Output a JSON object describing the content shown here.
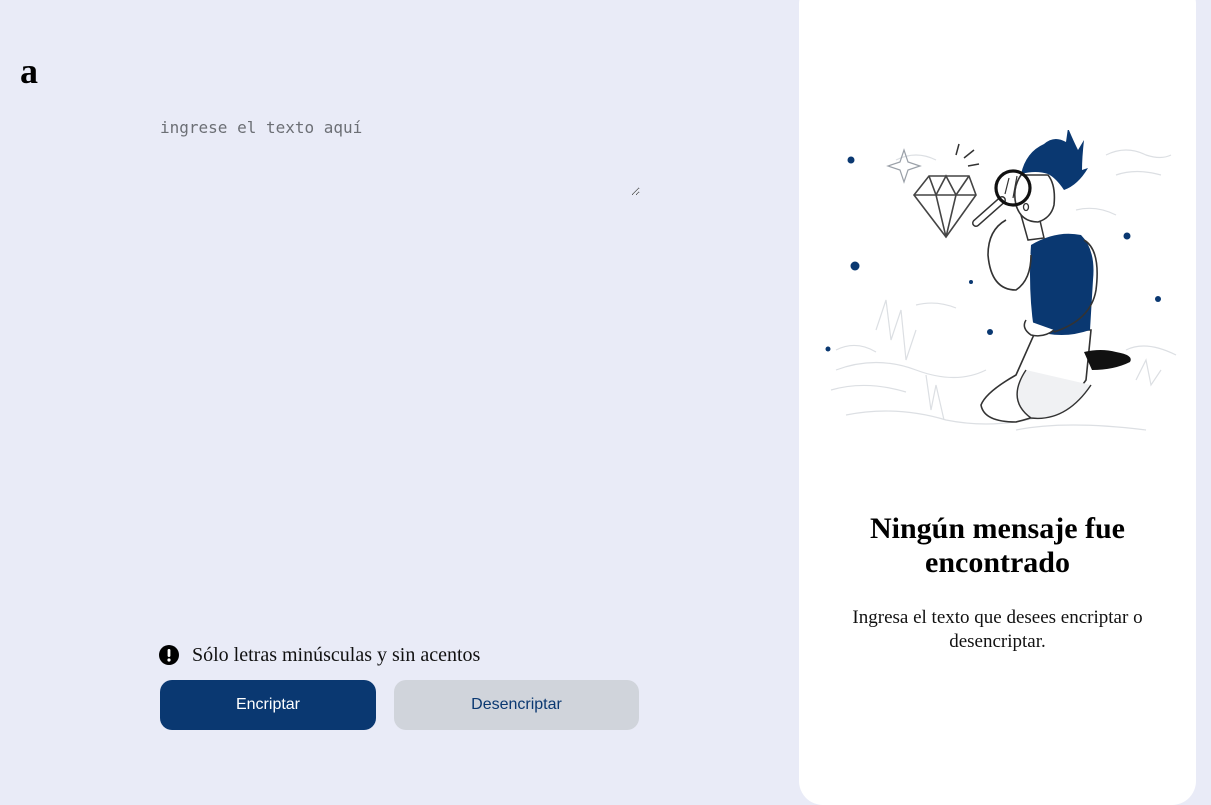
{
  "logo": {
    "text": "a"
  },
  "input": {
    "placeholder": "ingrese el texto aquí",
    "value": ""
  },
  "notice": {
    "icon": "exclamation-circle-icon",
    "text": "Sólo letras minúsculas y sin acentos"
  },
  "buttons": {
    "encrypt_label": "Encriptar",
    "decrypt_label": "Desencriptar"
  },
  "output_panel": {
    "illustration": "person-with-magnifying-glass-and-diamond",
    "title": "Ningún mensaje fue encontrado",
    "message": "Ingresa el texto que desees encriptar o desencriptar."
  },
  "colors": {
    "background": "#e9ebf7",
    "primary": "#0a3871",
    "secondary": "#d0d4db",
    "panel": "#ffffff"
  }
}
